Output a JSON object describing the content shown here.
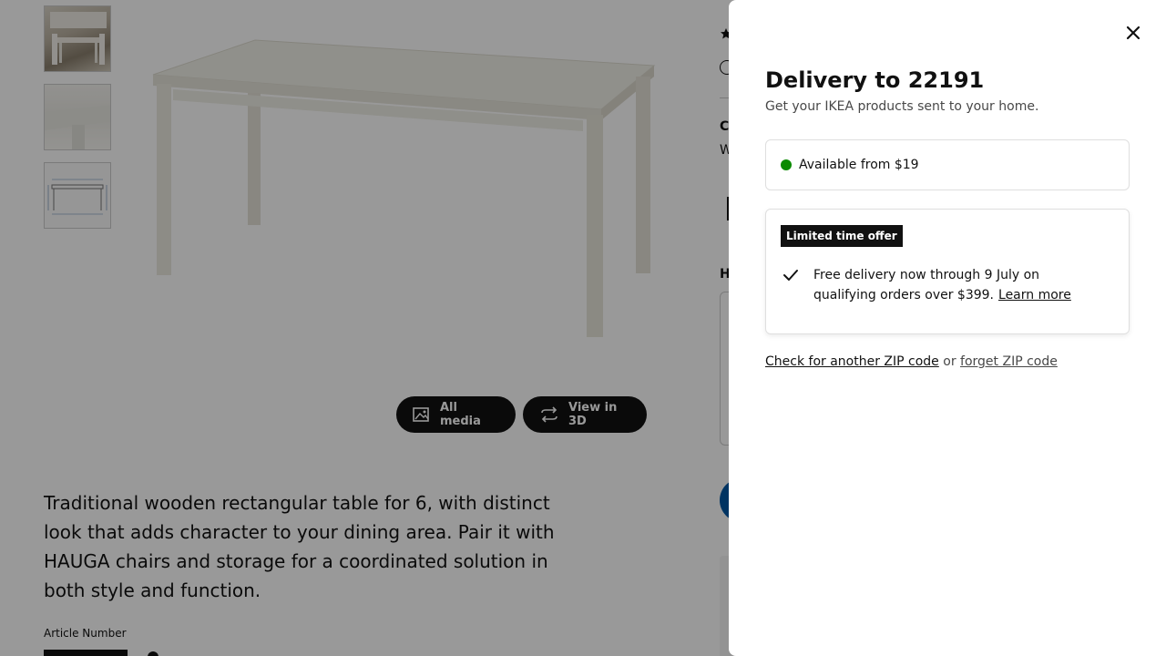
{
  "background": {
    "thumbnails": [
      "Dining room photo",
      "Table corner detail",
      "Table dimensions drawing"
    ],
    "media_buttons": {
      "all_media": "All media",
      "view_3d": "View in 3D"
    },
    "description": "Traditional wooden rectangular table for 6, with distinct look that adds character to your dining area. Pair it with HAUGA chairs and storage for a coordinated solution in both style and function.",
    "article_number_label": "Article Number",
    "right_column": {
      "section_c": "C",
      "section_w": "W",
      "section_h": "H"
    }
  },
  "panel": {
    "title": "Delivery to 22191",
    "subtitle": "Get your IKEA products sent to your home.",
    "availability": "Available from $19",
    "offer": {
      "badge": "Limited time offer",
      "text": "Free delivery now through 9 July on qualifying orders over $399.",
      "link": "Learn more"
    },
    "zip": {
      "check_link": "Check for another ZIP code",
      "or": "or",
      "forget_link": "forget ZIP code"
    }
  },
  "colors": {
    "accent_blue": "#0058a3",
    "available_green": "#0a8a00",
    "overlay": "rgba(0,0,0,0.4)"
  }
}
